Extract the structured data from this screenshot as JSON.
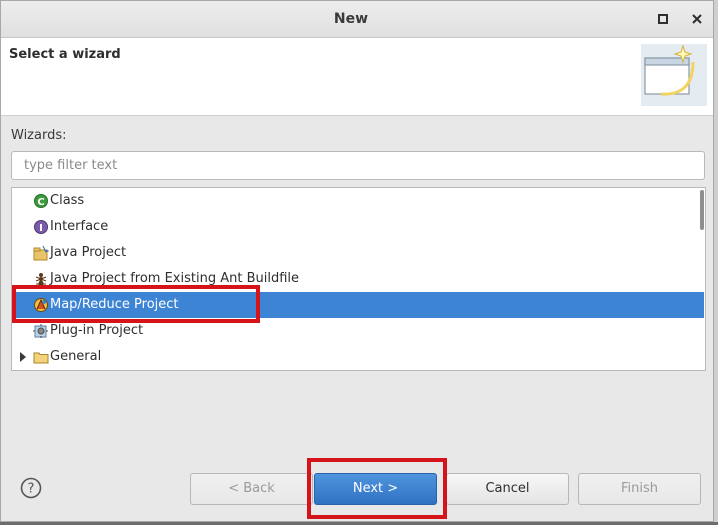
{
  "window": {
    "title": "New"
  },
  "header": {
    "title": "Select a wizard"
  },
  "wizards_label": "Wizards:",
  "filter": {
    "placeholder": "type filter text",
    "value": ""
  },
  "tree": {
    "items": [
      {
        "label": "Class",
        "icon": "class-icon",
        "selected": false
      },
      {
        "label": "Interface",
        "icon": "interface-icon",
        "selected": false
      },
      {
        "label": "Java Project",
        "icon": "java-project-icon",
        "selected": false
      },
      {
        "label": "Java Project from Existing Ant Buildfile",
        "icon": "ant-icon",
        "selected": false
      },
      {
        "label": "Map/Reduce Project",
        "icon": "mapreduce-project-icon",
        "selected": true
      },
      {
        "label": "Plug-in Project",
        "icon": "plugin-project-icon",
        "selected": false
      },
      {
        "label": "General",
        "icon": "folder-icon",
        "selected": false,
        "expandable": true
      }
    ]
  },
  "buttons": {
    "back": "< Back",
    "next": "Next >",
    "cancel": "Cancel",
    "finish": "Finish"
  },
  "colors": {
    "selection": "#3d84d4",
    "highlight_box": "#d4141a",
    "primary_button": "#3a80cf"
  }
}
